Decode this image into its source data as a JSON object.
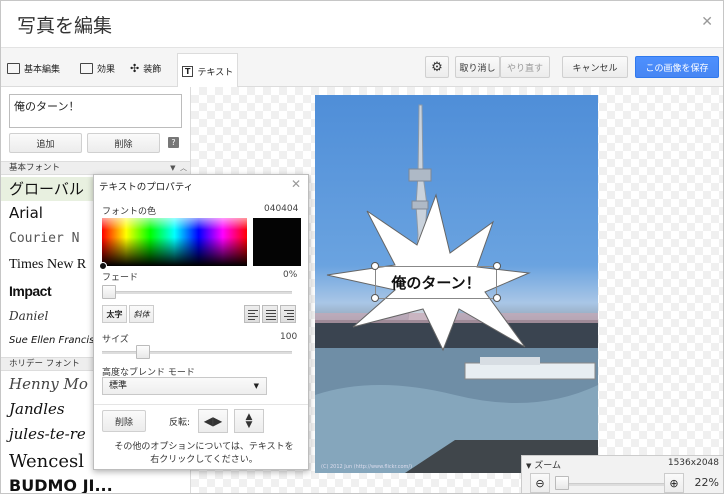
{
  "title": "写真を編集",
  "toolbar": {
    "tabs": [
      "基本編集",
      "効果",
      "装飾",
      "テキスト"
    ],
    "undo": "取り消し",
    "redo": "やり直す",
    "cancel": "キャンセル",
    "save": "この画像を保存"
  },
  "left": {
    "text_value": "俺のターン！",
    "add": "追加",
    "delete": "削除",
    "basic_fonts_header": "基本フォント",
    "fonts": [
      "グローバル",
      "Arial",
      "Courier N",
      "Times New R",
      "Impact",
      "Daniel",
      "Sue Ellen Francis"
    ],
    "holiday_fonts_header": "ホリデー フォント",
    "holiday_fonts": [
      "Henny Mo",
      "Jandles",
      "jules-te-re",
      "Wencesl",
      "BUDMO JI..."
    ]
  },
  "panel": {
    "title": "テキストのプロパティ",
    "font_color_label": "フォントの色",
    "font_color_value": "040404",
    "fade_label": "フェード",
    "fade_value": "0%",
    "bold": "太字",
    "italic": "斜体",
    "size_label": "サイズ",
    "size_value": "100",
    "blend_label": "高度なブレンド モード",
    "blend_value": "標準",
    "delete": "削除",
    "flip_label": "反転:",
    "hint": "その他のオプションについては、テキストを右クリックしてください。"
  },
  "canvas": {
    "overlay_text": "俺のターン！",
    "photo_caption": "(C) 2012 Jun (http://www.flickr.com/)"
  },
  "zoom": {
    "label": "ズーム",
    "size": "1536x2048",
    "percent": "22%",
    "level": 0.22
  },
  "colors": {
    "accent": "#4d90fe",
    "font_color": "#040404"
  }
}
